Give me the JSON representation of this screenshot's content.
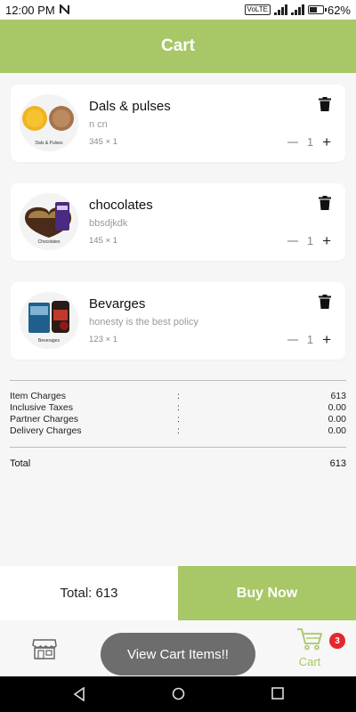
{
  "status_bar": {
    "time": "12:00 PM",
    "notification_icon": "n-notification-icon",
    "network_label": "VoLTE",
    "battery_percent": "62%",
    "battery_level": 0.62
  },
  "header": {
    "title": "Cart"
  },
  "items": [
    {
      "name": "Dals & pulses",
      "description": "n cn",
      "price_qty": "345 × 1",
      "quantity": "1",
      "thumb_label": "Dals & Pulses"
    },
    {
      "name": "chocolates",
      "description": "bbsdjkdk",
      "price_qty": "145 × 1",
      "quantity": "1",
      "thumb_label": "Chocolates"
    },
    {
      "name": "Bevarges",
      "description": "honesty is the best policy",
      "price_qty": "123 × 1",
      "quantity": "1",
      "thumb_label": "Beverages"
    }
  ],
  "charges": [
    {
      "label": "Item Charges",
      "colon": ":",
      "value": "613"
    },
    {
      "label": "Inclusive Taxes",
      "colon": ":",
      "value": "0.00"
    },
    {
      "label": "Partner Charges",
      "colon": ":",
      "value": "0.00"
    },
    {
      "label": "Delivery Charges",
      "colon": ":",
      "value": "0.00"
    }
  ],
  "total": {
    "label": "Total",
    "value": "613"
  },
  "checkout": {
    "total_text": "Total: 613",
    "buy_label": "Buy Now"
  },
  "bottom_nav": {
    "cart_label": "Cart",
    "cart_badge": "3"
  },
  "toast": {
    "text": "View Cart Items!!"
  },
  "colors": {
    "accent": "#a8c766",
    "badge": "#e5272d",
    "toast": "#6d6d6d"
  }
}
